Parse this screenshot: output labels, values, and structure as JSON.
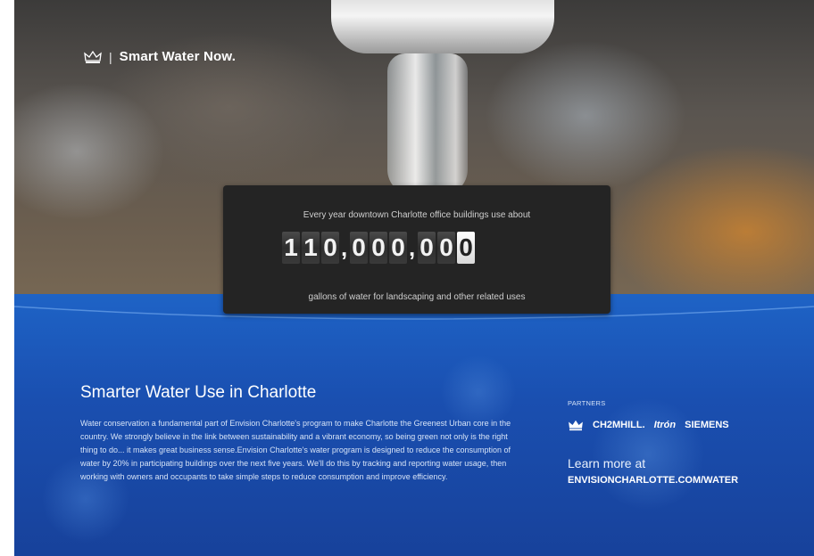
{
  "header": {
    "logo_icon": "crown-icon",
    "separator": "|",
    "brand": "Smart Water Now."
  },
  "counter": {
    "intro": "Every year downtown Charlotte office buildings use about",
    "digits": [
      "1",
      "1",
      "0",
      ",",
      "0",
      "0",
      "0",
      ",",
      "0",
      "0",
      "0"
    ],
    "value": "110,000,000",
    "outro": "gallons of water for landscaping and other related uses"
  },
  "section": {
    "title": "Smarter Water Use in Charlotte",
    "body": "Water conservation a fundamental part of Envision Charlotte's program to make Charlotte the Greenest Urban core in the country. We strongly believe in the link between sustainability and a vibrant economy, so being green not only is the right thing to do... it makes great business sense.Envision Charlotte's water program is designed to reduce the consumption of water by 20% in participating buildings over the next five years. We'll do this by tracking and reporting water usage, then working with owners and occupants to take simple steps to reduce consumption and improve efficiency."
  },
  "partners": {
    "label": "PARTNERS",
    "crown_icon": "crown-icon",
    "items": [
      "CH2MHILL.",
      "Itrón",
      "SIEMENS"
    ]
  },
  "cta": {
    "learn": "Learn more at",
    "url": "ENVISIONCHARLOTTE.COM/WATER"
  },
  "colors": {
    "panel_blue": "#1a4fb0",
    "counter_bg": "#242424"
  }
}
